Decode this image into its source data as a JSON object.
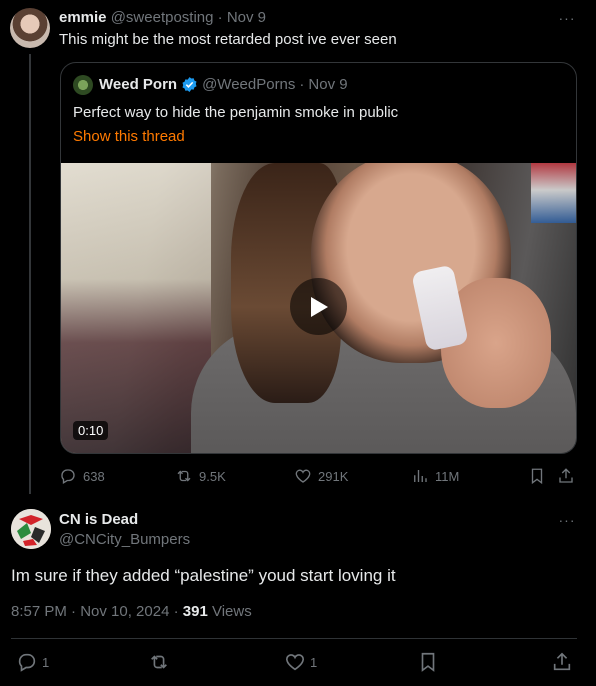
{
  "parent": {
    "name": "emmie",
    "handle": "@sweetposting",
    "sep": "·",
    "date": "Nov 9",
    "text": "This might be the most retarded post ive ever seen",
    "more": "···"
  },
  "quote": {
    "name": "Weed Porn",
    "handle": "@WeedPorns",
    "sep": "·",
    "date": "Nov 9",
    "text": "Perfect way to hide the penjamin smoke in public",
    "thread_link": "Show this thread",
    "video_duration": "0:10"
  },
  "parent_actions": {
    "replies": "638",
    "reposts": "9.5K",
    "likes": "291K",
    "views": "11M"
  },
  "reply": {
    "name": "CN is Dead",
    "handle": "@CNCity_Bumpers",
    "text": "Im sure if they added “palestine” youd start loving it",
    "time": "8:57 PM · Nov 10, 2024 · ",
    "views_count": "391",
    "views_label": " Views",
    "more": "···",
    "replies": "1",
    "likes": "1"
  },
  "colors": {
    "background": "#000000",
    "text": "#e7e9ea",
    "muted": "#71767b",
    "link": "#ff7a00",
    "verified": "#1d9bf0",
    "border": "#333639"
  }
}
